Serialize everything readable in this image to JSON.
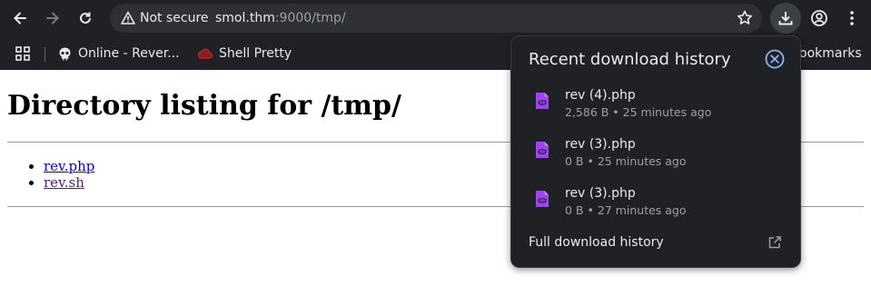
{
  "browser": {
    "security_label": "Not secure",
    "url_host": "smol.thm",
    "url_rest": ":9000/tmp/"
  },
  "bookmarks": {
    "items": [
      {
        "label": "Online - Rever..."
      },
      {
        "label": "Shell Pretty"
      },
      {
        "label": "ookmarks"
      }
    ]
  },
  "page": {
    "heading": "Directory listing for /tmp/",
    "links": [
      {
        "label": "rev.php"
      },
      {
        "label": "rev.sh"
      }
    ]
  },
  "downloads_popup": {
    "title": "Recent download history",
    "items": [
      {
        "name": "rev (4).php",
        "meta": "2,586 B • 25 minutes ago"
      },
      {
        "name": "rev (3).php",
        "meta": "0 B • 25 minutes ago"
      },
      {
        "name": "rev (3).php",
        "meta": "0 B • 27 minutes ago"
      }
    ],
    "full_history_label": "Full download history"
  },
  "colors": {
    "chrome_bg": "#202124",
    "omnibox_bg": "#2f3034",
    "file_icon": "#a142f4",
    "link": "#0000ee",
    "visited_link": "#551a8b"
  }
}
